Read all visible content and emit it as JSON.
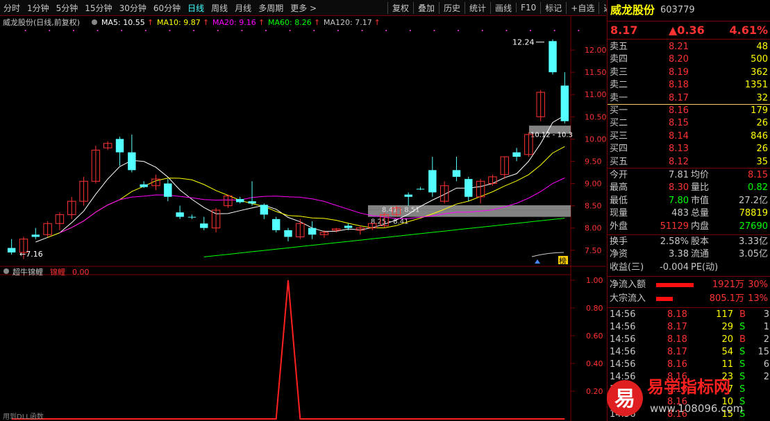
{
  "toolbar": {
    "periods": [
      "分时",
      "1分钟",
      "5分钟",
      "15分钟",
      "30分钟",
      "60分钟",
      "日线",
      "周线",
      "月线",
      "多周期",
      "更多 >"
    ],
    "active_period": "日线",
    "actions": [
      "复权",
      "叠加",
      "历史",
      "统计",
      "画线",
      "F10",
      "标记",
      "+自选",
      "返回"
    ]
  },
  "chart_header": {
    "stock_name": "威龙股份",
    "mode": "(日线,前复权)",
    "ma": [
      {
        "label": "MA5: 10.55",
        "color": "#ffffff"
      },
      {
        "label": "MA10: 9.87",
        "color": "#ffff00"
      },
      {
        "label": "MA20: 9.16",
        "color": "#ff00ff"
      },
      {
        "label": "MA60: 8.26",
        "color": "#00ff00"
      },
      {
        "label": "MA120: 7.17",
        "color": "#c8c8c8"
      }
    ]
  },
  "annotations": {
    "high_label": "12.24",
    "low_label": "7.16",
    "zone_label_1": "8.41 - 8.51",
    "zone_label_2": "8.25 - 8.41",
    "zone_label_3": "10.12 - 10.3",
    "tag": "榜"
  },
  "chart_data": [
    {
      "type": "candlestick",
      "ylim": [
        7.2,
        12.5
      ],
      "yticks": [
        "12.00",
        "11.50",
        "11.00",
        "10.50",
        "10.00",
        "9.50",
        "9.00",
        "8.50",
        "8.00",
        "7.50"
      ],
      "candles": [
        {
          "o": 7.55,
          "c": 7.45,
          "h": 7.75,
          "l": 7.4,
          "up": false
        },
        {
          "o": 7.45,
          "c": 7.75,
          "h": 7.8,
          "l": 7.3,
          "up": true
        },
        {
          "o": 7.8,
          "c": 7.85,
          "h": 8.0,
          "l": 7.75,
          "up": false
        },
        {
          "o": 7.85,
          "c": 8.1,
          "h": 8.15,
          "l": 7.8,
          "up": true
        },
        {
          "o": 8.1,
          "c": 8.3,
          "h": 8.35,
          "l": 7.95,
          "up": true
        },
        {
          "o": 8.3,
          "c": 8.6,
          "h": 8.7,
          "l": 8.2,
          "up": true
        },
        {
          "o": 8.6,
          "c": 9.05,
          "h": 9.15,
          "l": 8.5,
          "up": true
        },
        {
          "o": 9.05,
          "c": 9.75,
          "h": 9.85,
          "l": 9.0,
          "up": true
        },
        {
          "o": 9.9,
          "c": 9.8,
          "h": 9.95,
          "l": 9.75,
          "up": true
        },
        {
          "o": 10.0,
          "c": 9.7,
          "h": 10.05,
          "l": 9.4,
          "up": false
        },
        {
          "o": 9.7,
          "c": 9.3,
          "h": 10.1,
          "l": 9.25,
          "up": false
        },
        {
          "o": 8.98,
          "c": 8.92,
          "h": 9.05,
          "l": 8.9,
          "up": false
        },
        {
          "o": 8.95,
          "c": 9.1,
          "h": 9.2,
          "l": 8.85,
          "up": true
        },
        {
          "o": 9.0,
          "c": 8.7,
          "h": 9.1,
          "l": 8.6,
          "up": false
        },
        {
          "o": 8.35,
          "c": 8.25,
          "h": 8.5,
          "l": 8.2,
          "up": false
        },
        {
          "o": 8.25,
          "c": 8.25,
          "h": 8.3,
          "l": 8.2,
          "up": false
        },
        {
          "o": 8.1,
          "c": 8.0,
          "h": 8.25,
          "l": 7.95,
          "up": false
        },
        {
          "o": 8.0,
          "c": 8.4,
          "h": 8.45,
          "l": 7.9,
          "up": true
        },
        {
          "o": 8.5,
          "c": 8.72,
          "h": 8.75,
          "l": 8.45,
          "up": true
        },
        {
          "o": 8.65,
          "c": 8.58,
          "h": 8.7,
          "l": 8.55,
          "up": false
        },
        {
          "o": 8.6,
          "c": 8.55,
          "h": 9.05,
          "l": 8.5,
          "up": false
        },
        {
          "o": 8.52,
          "c": 8.3,
          "h": 8.55,
          "l": 8.2,
          "up": false
        },
        {
          "o": 8.2,
          "c": 7.95,
          "h": 8.25,
          "l": 7.9,
          "up": false
        },
        {
          "o": 7.95,
          "c": 7.8,
          "h": 8.0,
          "l": 7.7,
          "up": false
        },
        {
          "o": 7.8,
          "c": 8.1,
          "h": 8.2,
          "l": 7.75,
          "up": true
        },
        {
          "o": 8.0,
          "c": 7.85,
          "h": 8.15,
          "l": 7.75,
          "up": false
        },
        {
          "o": 7.85,
          "c": 7.9,
          "h": 7.95,
          "l": 7.78,
          "up": true
        },
        {
          "o": 7.95,
          "c": 7.98,
          "h": 8.0,
          "l": 7.9,
          "up": true
        },
        {
          "o": 8.0,
          "c": 8.05,
          "h": 8.1,
          "l": 7.95,
          "up": false
        },
        {
          "o": 7.95,
          "c": 8.0,
          "h": 8.05,
          "l": 7.85,
          "up": true
        },
        {
          "o": 8.0,
          "c": 8.1,
          "h": 8.1,
          "l": 7.95,
          "up": true
        },
        {
          "o": 8.05,
          "c": 8.3,
          "h": 8.35,
          "l": 8.0,
          "up": true
        },
        {
          "o": 8.3,
          "c": 8.45,
          "h": 8.5,
          "l": 8.25,
          "up": true
        },
        {
          "o": 8.75,
          "c": 8.7,
          "h": 8.8,
          "l": 8.5,
          "up": false
        },
        {
          "o": 8.88,
          "c": 8.88,
          "h": 8.92,
          "l": 8.85,
          "up": false
        },
        {
          "o": 9.3,
          "c": 8.8,
          "h": 9.6,
          "l": 8.7,
          "up": false
        },
        {
          "o": 8.6,
          "c": 8.95,
          "h": 9.05,
          "l": 8.55,
          "up": true
        },
        {
          "o": 9.3,
          "c": 9.15,
          "h": 9.6,
          "l": 9.05,
          "up": false
        },
        {
          "o": 9.1,
          "c": 8.7,
          "h": 9.15,
          "l": 8.6,
          "up": false
        },
        {
          "o": 8.7,
          "c": 9.05,
          "h": 9.1,
          "l": 8.55,
          "up": true
        },
        {
          "o": 9.0,
          "c": 9.15,
          "h": 9.2,
          "l": 8.95,
          "up": true
        },
        {
          "o": 9.2,
          "c": 9.6,
          "h": 9.6,
          "l": 9.1,
          "up": true
        },
        {
          "o": 9.7,
          "c": 9.6,
          "h": 9.8,
          "l": 9.5,
          "up": false
        },
        {
          "o": 9.65,
          "c": 10.1,
          "h": 10.15,
          "l": 9.6,
          "up": true
        },
        {
          "o": 10.5,
          "c": 11.05,
          "h": 11.1,
          "l": 10.4,
          "up": true
        },
        {
          "o": 12.2,
          "c": 11.5,
          "h": 12.24,
          "l": 11.45,
          "up": false
        },
        {
          "o": 11.2,
          "c": 10.4,
          "h": 11.5,
          "l": 10.35,
          "up": false
        }
      ],
      "zones": [
        [
          8.41,
          8.51
        ],
        [
          8.25,
          8.41
        ],
        [
          10.12,
          10.3
        ]
      ]
    },
    {
      "type": "line",
      "name": "锦鲤",
      "ylim": [
        0,
        1.0
      ],
      "yticks": [
        "1.00",
        "0.80",
        "0.60",
        "0.40",
        "0.20"
      ],
      "values": [
        0,
        0,
        0,
        0,
        0,
        0,
        0,
        0,
        0,
        0,
        0,
        0,
        0,
        0,
        0,
        0,
        0,
        0,
        0,
        0,
        0,
        0,
        0,
        1,
        0,
        0,
        0,
        0,
        0,
        0,
        0,
        0,
        0,
        0,
        0,
        0,
        0,
        0,
        0,
        0,
        0,
        0,
        0,
        0,
        0,
        0,
        0
      ]
    }
  ],
  "indicator": {
    "title": "超牛锦鲤",
    "series_label": "锦鲤",
    "value": "0.00",
    "footer": "用到DLL函数"
  },
  "quote": {
    "name": "威龙股份",
    "code": "603779",
    "price": "8.17",
    "change": "▲0.36",
    "pct": "4.61%",
    "asks": [
      {
        "label": "卖五",
        "price": "8.21",
        "vol": "48"
      },
      {
        "label": "卖四",
        "price": "8.20",
        "vol": "500"
      },
      {
        "label": "卖三",
        "price": "8.19",
        "vol": "362"
      },
      {
        "label": "卖二",
        "price": "8.18",
        "vol": "1351"
      },
      {
        "label": "卖一",
        "price": "8.17",
        "vol": "32"
      }
    ],
    "bids": [
      {
        "label": "买一",
        "price": "8.16",
        "vol": "179"
      },
      {
        "label": "买二",
        "price": "8.15",
        "vol": "26"
      },
      {
        "label": "买三",
        "price": "8.14",
        "vol": "846"
      },
      {
        "label": "买四",
        "price": "8.13",
        "vol": "26"
      },
      {
        "label": "买五",
        "price": "8.12",
        "vol": "35"
      }
    ],
    "stats": [
      [
        {
          "k": "今开",
          "v": "7.81"
        },
        {
          "k": "均价",
          "v": "8.15"
        }
      ],
      [
        {
          "k": "最高",
          "v": "8.30"
        },
        {
          "k": "量比",
          "v": "0.82"
        }
      ],
      [
        {
          "k": "最低",
          "v": "7.80"
        },
        {
          "k": "市值",
          "v": "27.2亿"
        }
      ],
      [
        {
          "k": "现量",
          "v": "483"
        },
        {
          "k": "总量",
          "v": "78819"
        }
      ],
      [
        {
          "k": "外盘",
          "v": "51129"
        },
        {
          "k": "内盘",
          "v": "27690"
        }
      ]
    ],
    "fin": [
      [
        {
          "k": "换手",
          "v": "2.58%"
        },
        {
          "k": "股本",
          "v": "3.33亿"
        }
      ],
      [
        {
          "k": "净资",
          "v": "3.38"
        },
        {
          "k": "流通",
          "v": "3.05亿"
        }
      ],
      [
        {
          "k": "收益(三)",
          "v": "-0.004"
        },
        {
          "k": "PE(动)",
          "v": ""
        }
      ]
    ],
    "flows": [
      {
        "label": "净流入额",
        "bar": 0.9,
        "amount": "1921万",
        "pct": "30%"
      },
      {
        "label": "大宗流入",
        "bar": 0.4,
        "amount": "805.1万",
        "pct": "13%"
      }
    ],
    "ticks": [
      {
        "time": "14:56",
        "price": "8.18",
        "vol": "117",
        "side": "B",
        "n": "3"
      },
      {
        "time": "14:56",
        "price": "8.17",
        "vol": "29",
        "side": "S",
        "n": "1"
      },
      {
        "time": "14:56",
        "price": "8.18",
        "vol": "20",
        "side": "B",
        "n": "2"
      },
      {
        "time": "14:56",
        "price": "8.17",
        "vol": "54",
        "side": "S",
        "n": "15"
      },
      {
        "time": "14:56",
        "price": "8.16",
        "vol": "11",
        "side": "S",
        "n": "6"
      },
      {
        "time": "14:56",
        "price": "8.16",
        "vol": "23",
        "side": "S",
        "n": "2"
      },
      {
        "time": "14:56",
        "price": "8.16",
        "vol": "7",
        "side": "S",
        "n": ""
      },
      {
        "time": "14:56",
        "price": "8.16",
        "vol": "10",
        "side": "S",
        "n": ""
      },
      {
        "time": "14:56",
        "price": "8.16",
        "vol": "15",
        "side": "S",
        "n": ""
      }
    ]
  },
  "watermark": {
    "brand": "易学指标网",
    "url": "www.108096.com",
    "logo": "易"
  },
  "colors": {
    "up": "#ff3232",
    "down": "#54ffff",
    "axis": "#7a0000",
    "grid": "#3a0000",
    "ma5": "#ffffff",
    "ma10": "#ffff00",
    "ma20": "#ff00ff",
    "ma60": "#00ff00",
    "ma120": "#c8c8c8",
    "zone": "#9a9a9a"
  }
}
